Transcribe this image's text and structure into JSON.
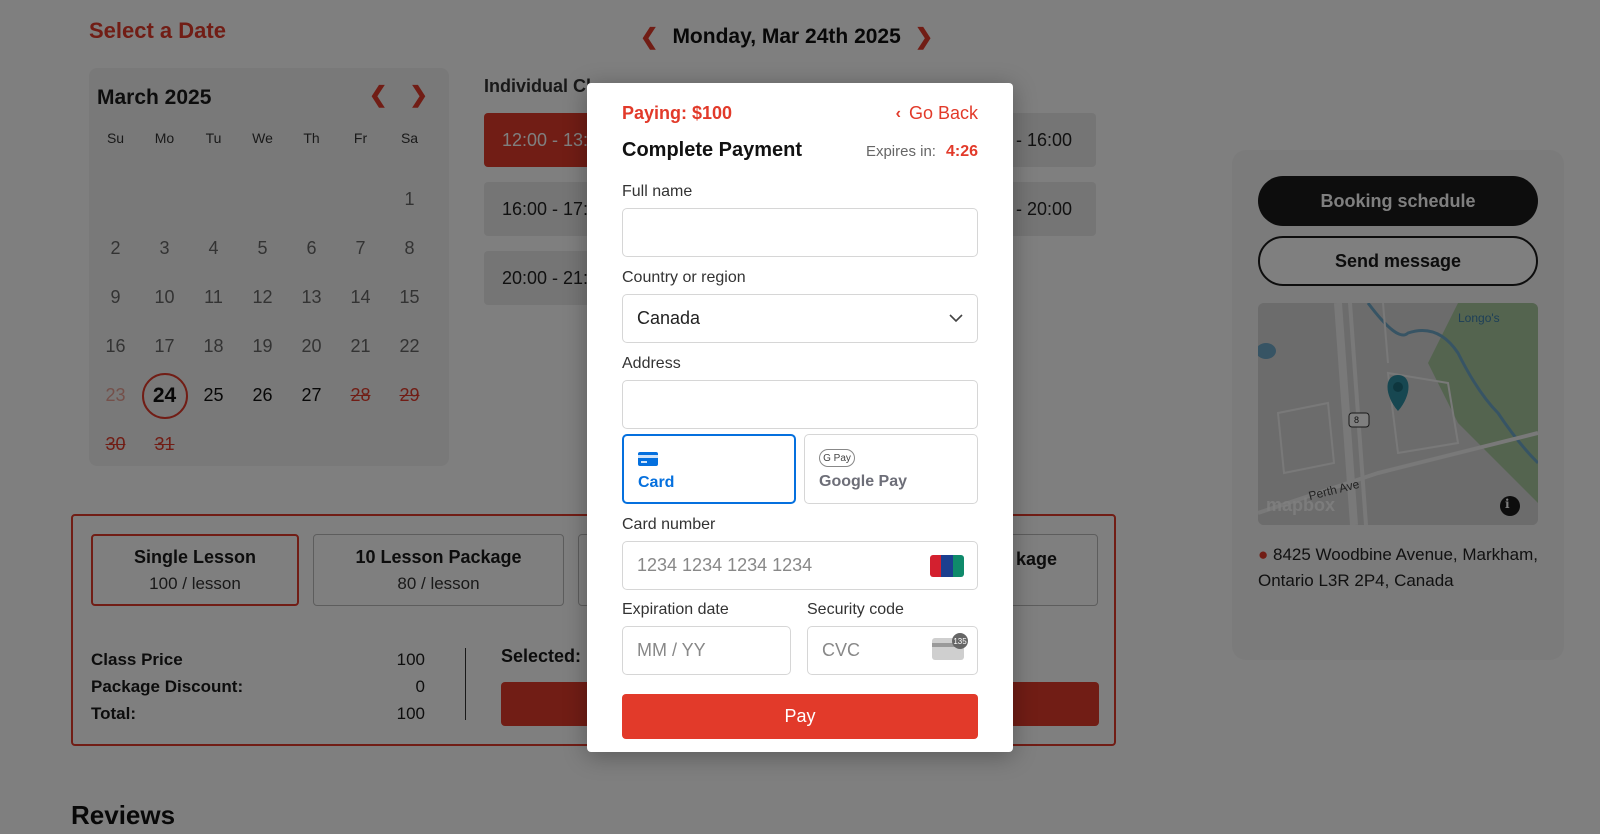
{
  "header": {
    "select_date": "Select a Date",
    "current_date": "Monday, Mar 24th 2025"
  },
  "calendar": {
    "month": "March 2025",
    "weekdays": [
      "Su",
      "Mo",
      "Tu",
      "We",
      "Th",
      "Fr",
      "Sa"
    ],
    "days": [
      "1",
      "2",
      "3",
      "4",
      "5",
      "6",
      "7",
      "8",
      "9",
      "10",
      "11",
      "12",
      "13",
      "14",
      "15",
      "16",
      "17",
      "18",
      "19",
      "20",
      "21",
      "22",
      "23",
      "24",
      "25",
      "26",
      "27",
      "28",
      "29",
      "30",
      "31"
    ]
  },
  "classes": {
    "title": "Individual Cl",
    "slots": [
      "12:00 - 13:",
      "16:00 - 17:",
      "20:00 - 21:",
      "- 16:00",
      "- 20:00"
    ]
  },
  "sidebar": {
    "booking_button": "Booking schedule",
    "message_button": "Send message",
    "map_labels": {
      "store": "Longo's",
      "road": "Perth Ave",
      "route": "8",
      "brand": "mapbox"
    },
    "address": "8425 Woodbine Avenue, Markham, Ontario L3R 2P4, Canada"
  },
  "packages": {
    "items": [
      {
        "name": "Single Lesson",
        "price": "100 / lesson"
      },
      {
        "name": "10 Lesson Package",
        "price": "80 / lesson"
      },
      {
        "name": "kage",
        "price": ""
      }
    ],
    "class_price_label": "Class Price",
    "class_price": "100",
    "discount_label": "Package Discount:",
    "discount": "0",
    "total_label": "Total:",
    "total": "100",
    "selected_label": "Selected:"
  },
  "reviews": {
    "title": "Reviews"
  },
  "modal": {
    "paying": "Paying: $100",
    "go_back": "Go Back",
    "title": "Complete Payment",
    "expires_label": "Expires in:",
    "expires_time": "4:26",
    "full_name_label": "Full name",
    "full_name_value": "",
    "country_label": "Country or region",
    "country_value": "Canada",
    "address_label": "Address",
    "address_value": "",
    "method_card": "Card",
    "method_gpay": "Google Pay",
    "gpay_badge": "G Pay",
    "card_number_label": "Card number",
    "card_number_placeholder": "1234 1234 1234 1234",
    "expiry_label": "Expiration date",
    "expiry_placeholder": "MM / YY",
    "security_label": "Security code",
    "security_placeholder": "CVC",
    "cvc_badge": "135",
    "pay_button": "Pay"
  },
  "colors": {
    "accent": "#e23a2a",
    "stripe_blue": "#0570de",
    "dark": "#1a1a1a"
  }
}
